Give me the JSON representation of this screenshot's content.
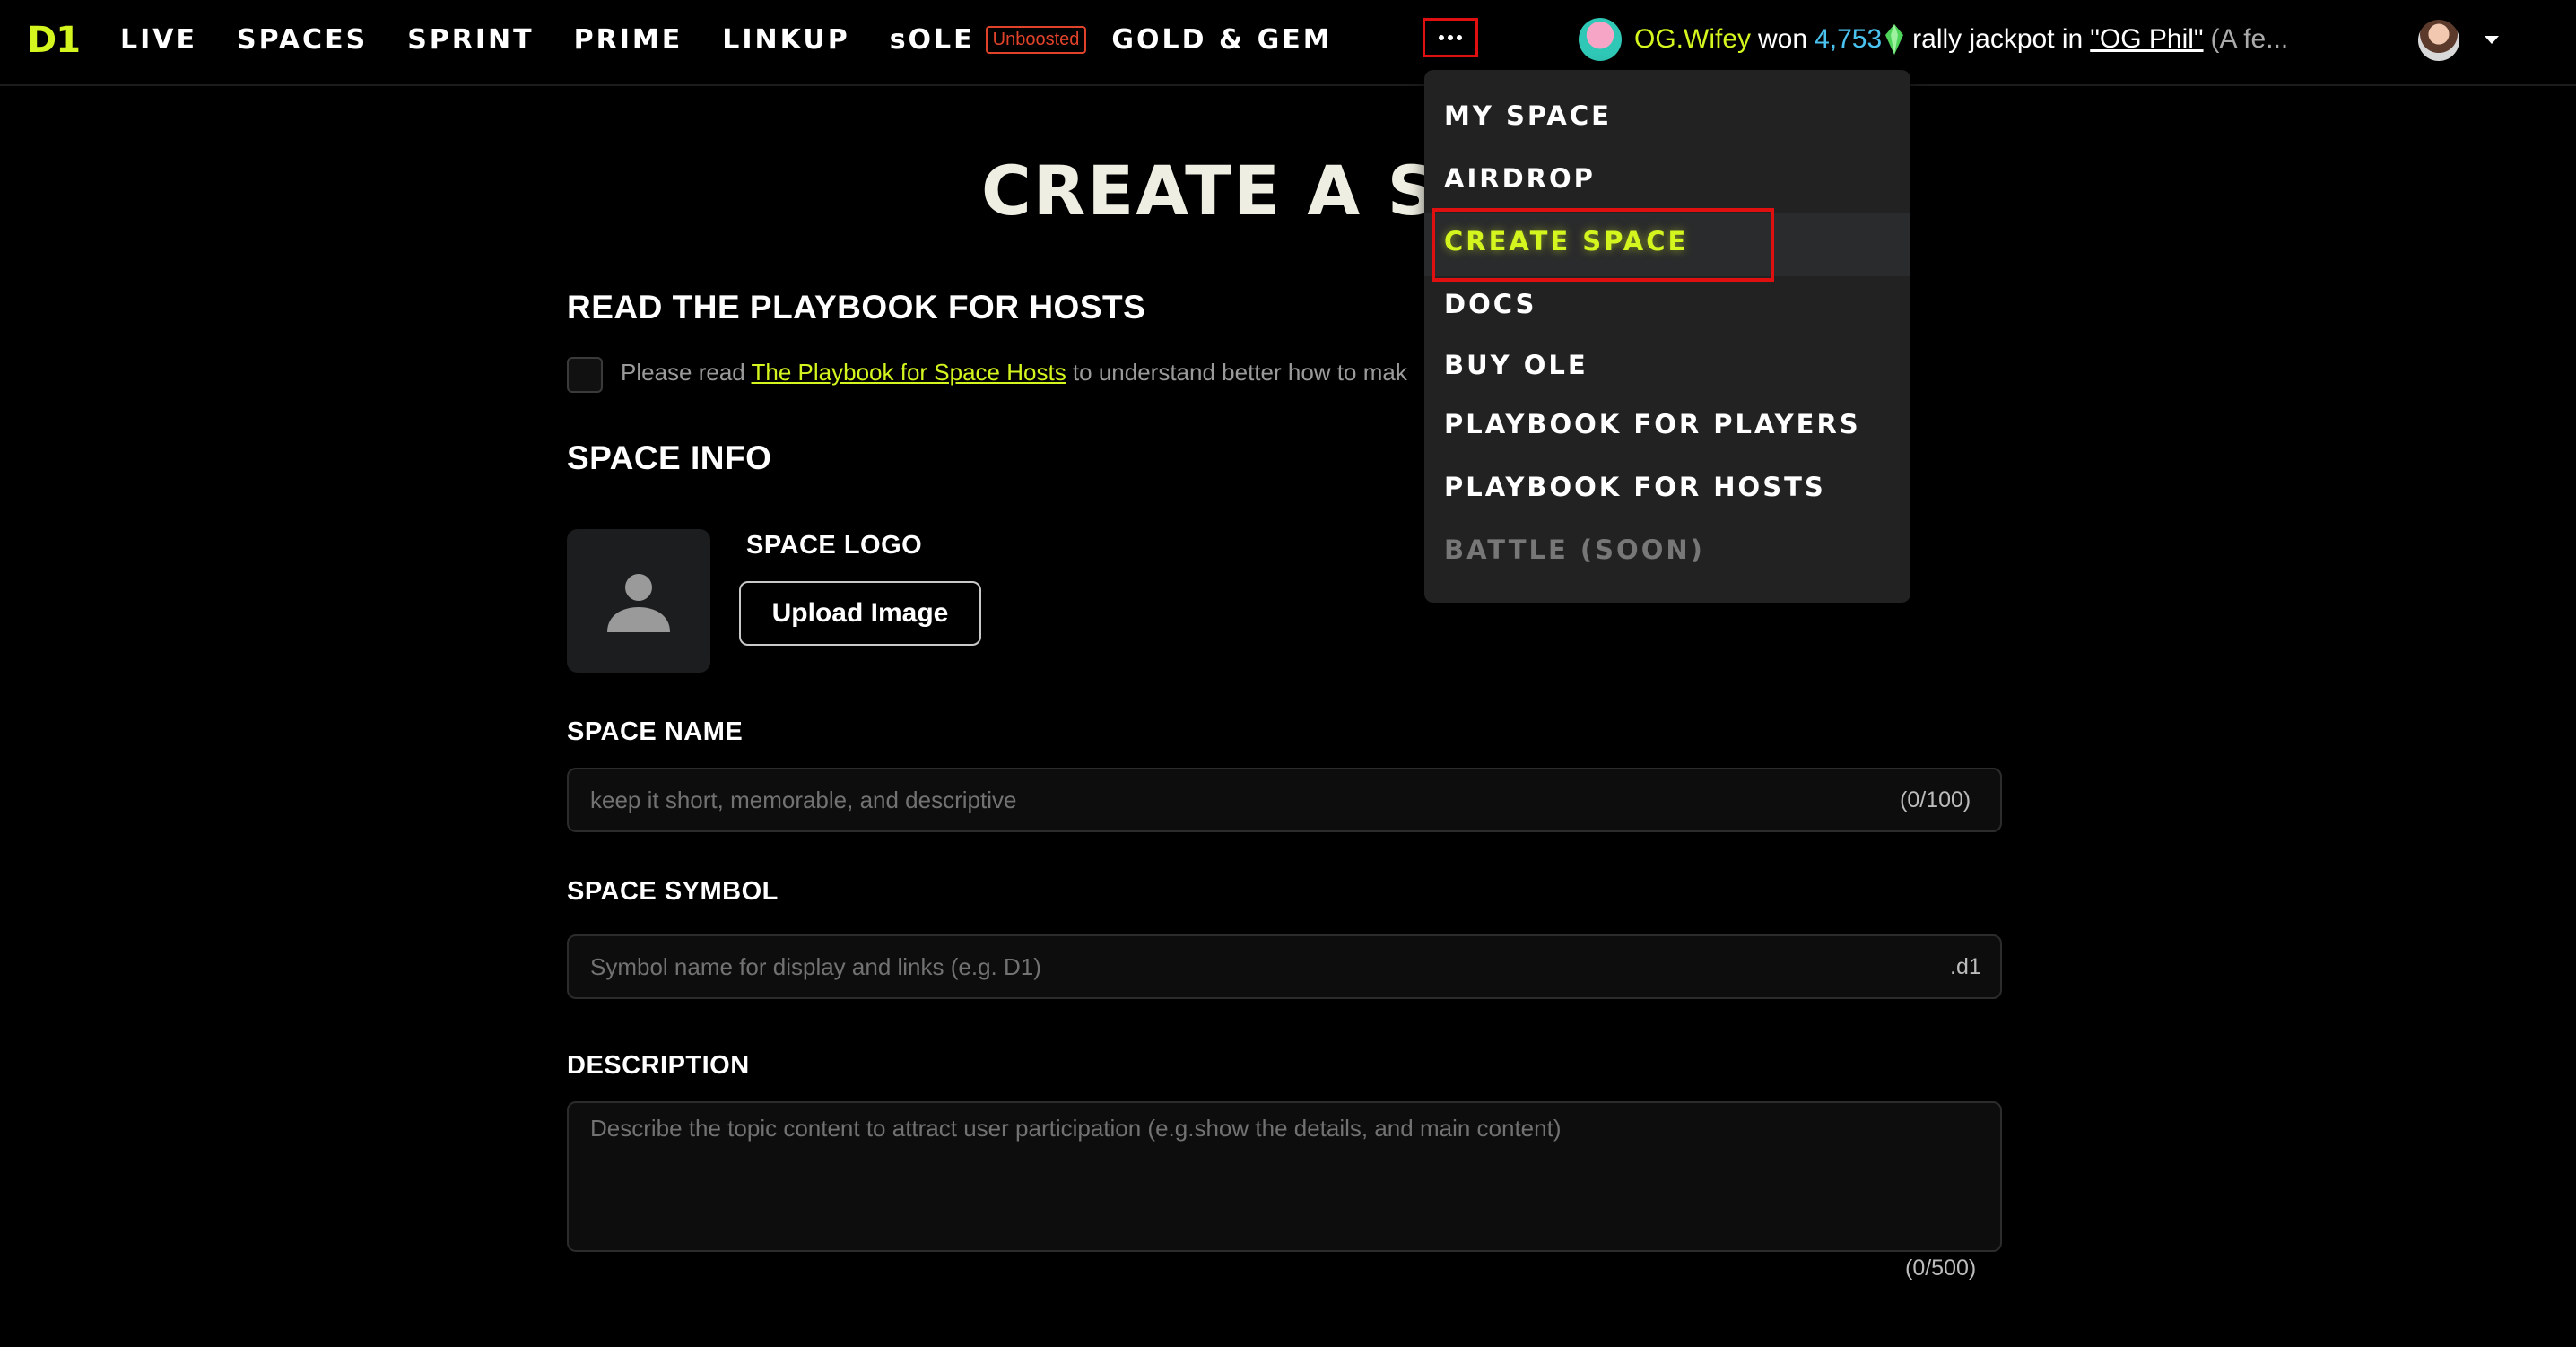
{
  "nav": {
    "logo": "D1",
    "items": [
      "LIVE",
      "SPACES",
      "SPRINT",
      "PRIME",
      "LINKUP"
    ],
    "sole_label": "sOLE",
    "sole_badge": "Unboosted",
    "gold_gem": "GOLD & GEM",
    "more_icon": "ellipsis-icon"
  },
  "ticker": {
    "user": "OG.Wifey",
    "won": "won",
    "amount": "4,753",
    "gem_icon": "green-gem-icon",
    "jackpot_text": "rally jackpot in",
    "space_link": "\"OG Phil\"",
    "tail": "(A fe..."
  },
  "page": {
    "title": "CREATE A SP",
    "playbook_heading": "READ THE PLAYBOOK FOR HOSTS",
    "playbook_prefix": "Please read ",
    "playbook_link": "The Playbook for Space Hosts",
    "playbook_suffix": " to understand better how to mak",
    "space_info_heading": "SPACE INFO",
    "space_logo_label": "SPACE LOGO",
    "upload_button": "Upload Image",
    "space_name_label": "SPACE NAME",
    "space_name_placeholder": "keep it short, memorable, and descriptive",
    "space_name_counter": "(0/100)",
    "space_symbol_label": "SPACE SYMBOL",
    "space_symbol_placeholder": "Symbol name for display and links (e.g. D1)",
    "space_symbol_suffix": ".d1",
    "description_label": "DESCRIPTION",
    "description_placeholder": "Describe the topic content to attract user participation (e.g.show the details, and main content)",
    "description_counter": "(0/500)"
  },
  "dropdown": {
    "items": [
      "MY SPACE",
      "AIRDROP",
      "CREATE SPACE",
      "DOCS",
      "BUY OLE",
      "PLAYBOOK FOR PLAYERS",
      "PLAYBOOK FOR HOSTS",
      "BATTLE (SOON)"
    ],
    "active": "CREATE SPACE",
    "disabled": "BATTLE (SOON)"
  },
  "colors": {
    "accent": "#d4f51e",
    "highlight_red": "#e01010",
    "amount_blue": "#4bc3f0",
    "badge_red": "#e1432a"
  }
}
